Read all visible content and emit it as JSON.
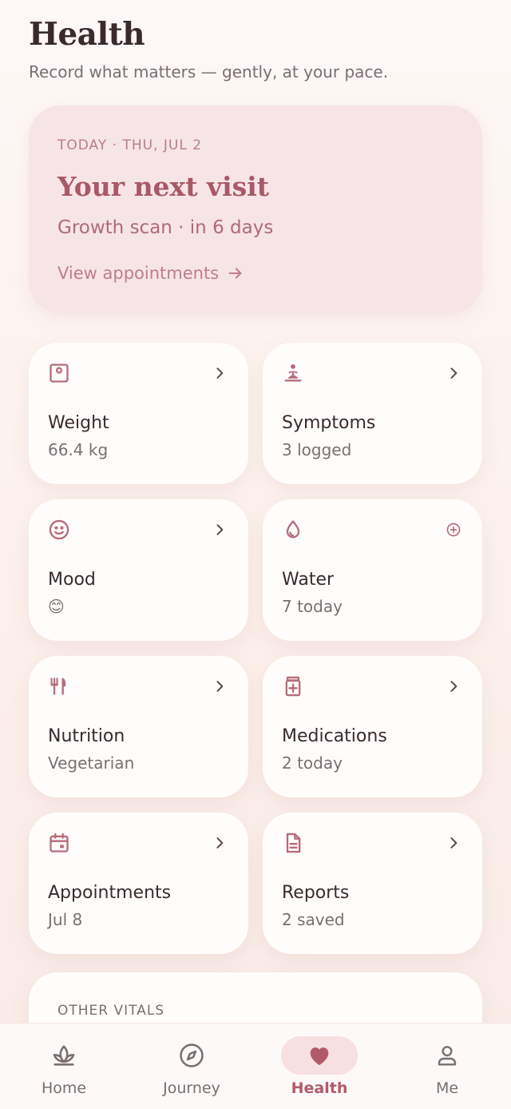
{
  "header": {
    "title": "Health",
    "subtitle": "Record what matters — gently, at your pace."
  },
  "hero": {
    "date": "TODAY · THU, JUL 2",
    "title": "Your next visit",
    "subtitle": "Growth scan · in 6 days",
    "link": "View appointments"
  },
  "cards": [
    {
      "label": "Weight",
      "value": "66.4 kg",
      "icon": "scale-icon",
      "action": "chevron"
    },
    {
      "label": "Symptoms",
      "value": "3 logged",
      "icon": "meditation-icon",
      "action": "chevron"
    },
    {
      "label": "Mood",
      "value": "😊",
      "icon": "smiley-icon",
      "action": "chevron"
    },
    {
      "label": "Water",
      "value": "7 today",
      "icon": "water-drop-icon",
      "action": "plus"
    },
    {
      "label": "Nutrition",
      "value": "Vegetarian",
      "icon": "utensils-icon",
      "action": "chevron"
    },
    {
      "label": "Medications",
      "value": "2 today",
      "icon": "medication-icon",
      "action": "chevron"
    },
    {
      "label": "Appointments",
      "value": "Jul 8",
      "icon": "calendar-icon",
      "action": "chevron"
    },
    {
      "label": "Reports",
      "value": "2 saved",
      "icon": "document-icon",
      "action": "chevron"
    }
  ],
  "vitals": {
    "title": "OTHER VITALS"
  },
  "nav": [
    {
      "label": "Home",
      "icon": "lotus-icon"
    },
    {
      "label": "Journey",
      "icon": "compass-icon"
    },
    {
      "label": "Health",
      "icon": "heart-icon",
      "active": true
    },
    {
      "label": "Me",
      "icon": "person-icon"
    }
  ],
  "colors": {
    "accent": "#b35a6a",
    "hero_bg": "#f6e4e6",
    "text": "#3a2a2c",
    "muted": "#7b6e70"
  }
}
